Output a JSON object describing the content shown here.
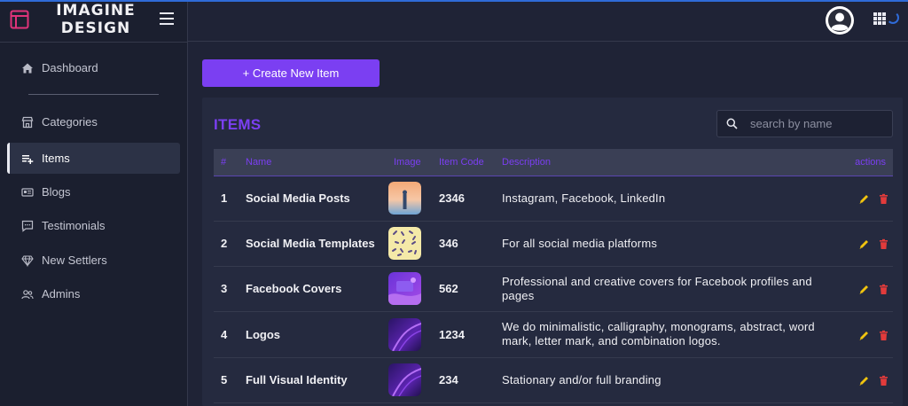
{
  "brand": {
    "name_line1": "IMAGINE",
    "name_line2": "DESIGN",
    "logo_icon": "layout-icon",
    "menu_icon": "hamburger-icon"
  },
  "colors": {
    "accent": "#7b3ff2",
    "sidebar_bg": "#1b1f2f",
    "panel_bg": "#252a3f",
    "edit": "#f1c40f",
    "delete": "#e23b3b"
  },
  "sidebar": {
    "items": [
      {
        "label": "Dashboard",
        "icon": "home-icon",
        "active": false
      },
      {
        "label": "Categories",
        "icon": "store-icon",
        "active": false
      },
      {
        "label": "Items",
        "icon": "playlist-add-icon",
        "active": true
      },
      {
        "label": "Blogs",
        "icon": "blog-card-icon",
        "active": false
      },
      {
        "label": "Testimonials",
        "icon": "comment-icon",
        "active": false
      },
      {
        "label": "New Settlers",
        "icon": "diamond-icon",
        "active": false
      },
      {
        "label": "Admins",
        "icon": "users-icon",
        "active": false
      }
    ]
  },
  "header": {
    "avatar_icon": "user-avatar-icon",
    "apps_icon": "grid-apps-icon"
  },
  "main": {
    "create_button_label": "+ Create New Item",
    "panel_title": "ITEMS",
    "search_placeholder": "search by name",
    "table": {
      "columns": [
        "#",
        "Name",
        "Image",
        "Item Code",
        "Description",
        "actions"
      ],
      "rows": [
        {
          "num": "1",
          "name": "Social Media Posts",
          "code": "2346",
          "description": "Instagram, Facebook, LinkedIn"
        },
        {
          "num": "2",
          "name": "Social Media Templates",
          "code": "346",
          "description": "For all social media platforms"
        },
        {
          "num": "3",
          "name": "Facebook Covers",
          "code": "562",
          "description": "Professional and creative covers for Facebook profiles and pages"
        },
        {
          "num": "4",
          "name": "Logos",
          "code": "1234",
          "description": "We do minimalistic, calligraphy, monograms, abstract, word mark, letter mark, and combination logos."
        },
        {
          "num": "5",
          "name": "Full Visual Identity",
          "code": "234",
          "description": "Stationary and/or full branding"
        }
      ]
    }
  }
}
